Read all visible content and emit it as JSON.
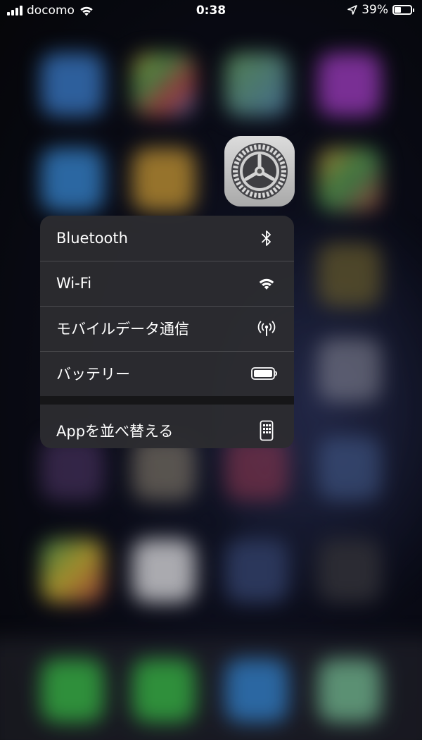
{
  "status_bar": {
    "carrier": "docomo",
    "time": "0:38",
    "battery_percent": "39%",
    "battery_level": 0.39,
    "icons": [
      "cellular-signal-icon",
      "wifi-icon",
      "location-arrow-icon",
      "battery-icon"
    ]
  },
  "app": {
    "name": "Settings",
    "icon": "settings-gear-icon"
  },
  "quick_actions": [
    {
      "label": "Bluetooth",
      "icon": "bluetooth-icon"
    },
    {
      "label": "Wi-Fi",
      "icon": "wifi-icon"
    },
    {
      "label": "モバイルデータ通信",
      "icon": "cellular-antenna-icon"
    },
    {
      "label": "バッテリー",
      "icon": "battery-icon"
    },
    {
      "label": "Appを並べ替える",
      "icon": "phone-grid-icon"
    }
  ],
  "colors": {
    "menu_background": "#2c2c30",
    "text": "#ffffff",
    "settings_icon_gray": "#a9a9a9"
  }
}
